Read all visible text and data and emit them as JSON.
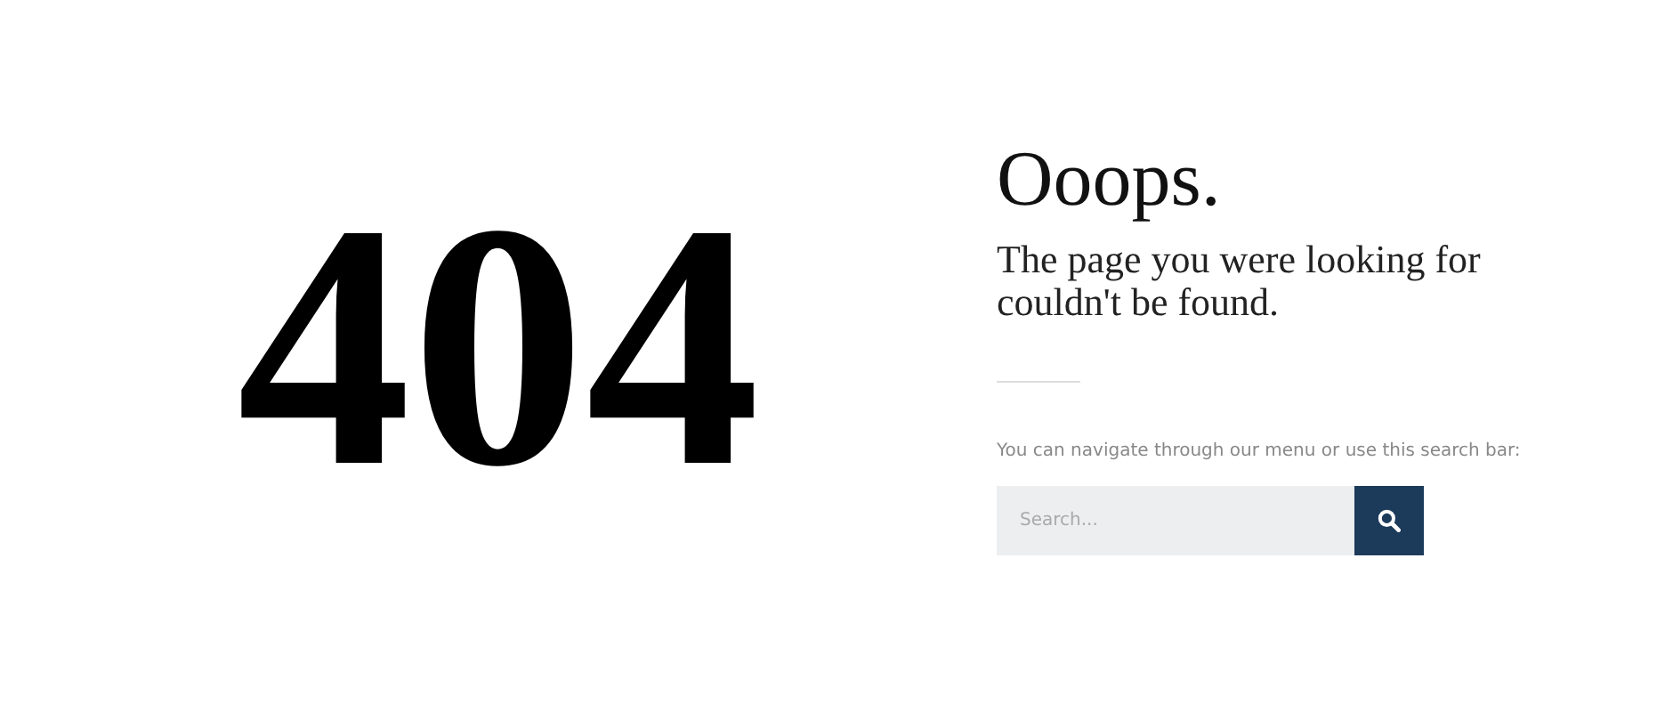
{
  "error_code": "404",
  "title": "Ooops.",
  "message": "The page you were looking for couldn't be found.",
  "hint": "You can navigate through our menu or use this search bar:",
  "search": {
    "placeholder": "Search..."
  }
}
